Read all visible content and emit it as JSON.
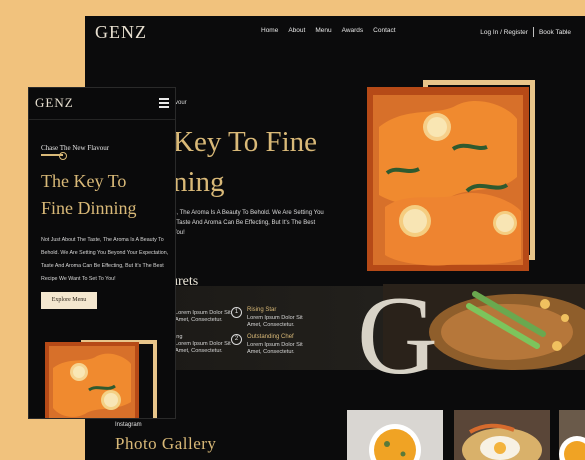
{
  "desktop": {
    "logo": "GENZ",
    "nav": [
      "Home",
      "About",
      "Menu",
      "Awards",
      "Contact"
    ],
    "login": "Log In / Register",
    "book": "Book Table",
    "hero": {
      "eyebrow": "vour",
      "title_line1": "Key To Fine",
      "title_line2": "ning",
      "para": [
        "e, The Aroma Is A Beauty To Behold. We Are Setting You",
        ", Taste And Aroma Can Be Effecting, But It's The Best",
        "You!",
        ""
      ]
    },
    "features": {
      "title_fragment": "urets",
      "left_items": [
        "Lorem Ipsum Dolor Sit\nAmet, Consectetur.",
        "ing\nLorem Ipsum Dolor Sit\nAmet, Consectetur."
      ],
      "right_items": [
        {
          "num": "1",
          "title": "Rising Star",
          "text": "Lorem Ipsum Dolor Sit\nAmet, Consectetur."
        },
        {
          "num": "2",
          "title": "Outstanding Chef",
          "text": "Lorem Ipsum Dolor Sit\nAmet, Consectetur."
        }
      ],
      "big_letter": "G"
    },
    "gallery": {
      "instagram": "Instagram",
      "title": "Photo Gallery"
    }
  },
  "mobile": {
    "logo": "GENZ",
    "menu_icon": "hamburger-icon",
    "tagline": "Chase The New Flavour",
    "title_line1": "The Key To",
    "title_line2": "Fine Dinning",
    "para": [
      "Not Just About The Taste, The Aroma Is A Beauty To",
      "Behold. We Are Setting You Beyond Your Expectation,",
      "Taste And Aroma Can Be Effecting, But It's The Best",
      "Recipe We Want To Set To You!"
    ],
    "button": "Explore Menu"
  },
  "colors": {
    "page_bg": "#f1c27d",
    "dark_bg": "#0b0b0c",
    "gold": "#d9b978",
    "frame": "#e8c58a",
    "light_text": "#e7e7e7"
  }
}
